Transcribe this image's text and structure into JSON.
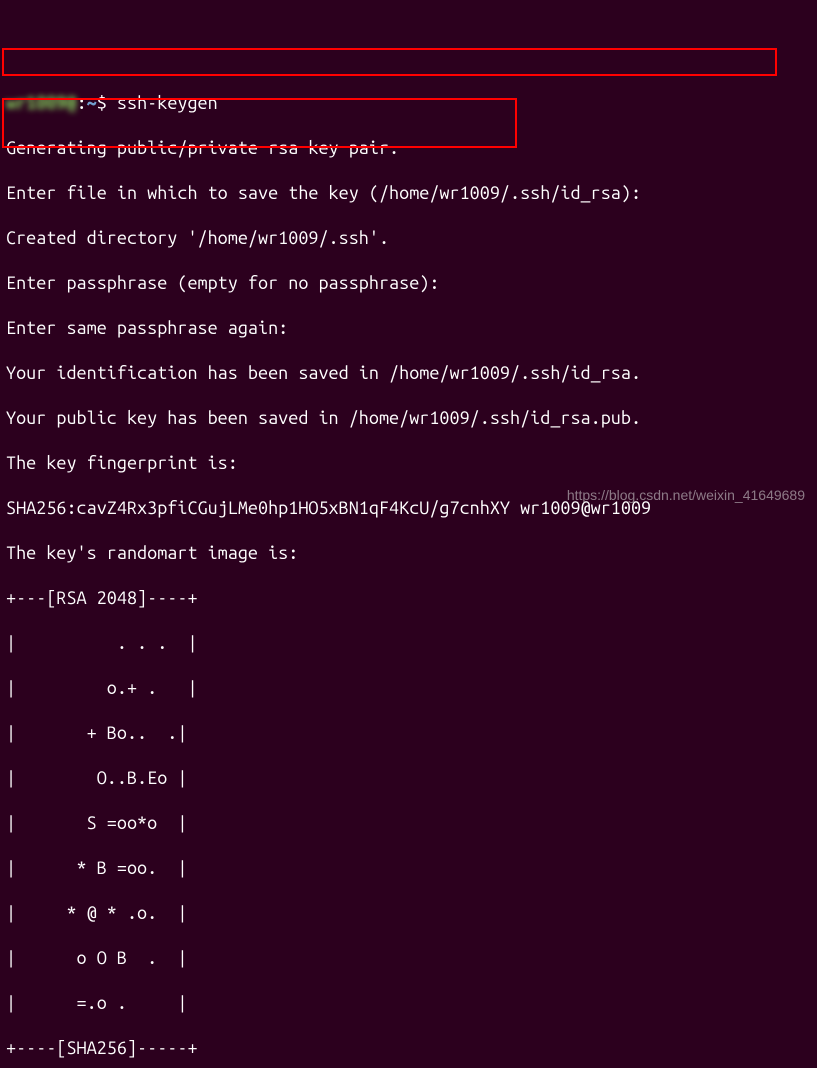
{
  "prompt": {
    "user_blurred": "wr1009@",
    "path": "~",
    "symbol": "$",
    "command": "ssh-keygen"
  },
  "lines": {
    "l1": "Generating public/private rsa key pair.",
    "l2": "Enter file in which to save the key (/home/wr1009/.ssh/id_rsa):",
    "l3": "Created directory '/home/wr1009/.ssh'.",
    "l4": "Enter passphrase (empty for no passphrase):",
    "l5": "Enter same passphrase again:",
    "l6": "Your identification has been saved in /home/wr1009/.ssh/id_rsa.",
    "l7": "Your public key has been saved in /home/wr1009/.ssh/id_rsa.pub.",
    "l8": "The key fingerprint is:",
    "l9": "SHA256:cavZ4Rx3pfiCGujLMe0hp1HO5xBN1qF4KcU/g7cnhXY wr1009@wr1009",
    "l10": "The key's randomart image is:",
    "l11": "+---[RSA 2048]----+",
    "l12": "|          . . .  |",
    "l13": "|         o.+ .   |",
    "l14": "|       + Bo..  .|",
    "l15": "|        O..B.Eo |",
    "l16": "|       S =oo*o  |",
    "l17": "|      * B =oo.  |",
    "l18": "|     * @ * .o.  |",
    "l19": "|      o O B  .  |",
    "l20": "|      =.o .     |",
    "l21": "+----[SHA256]-----+"
  },
  "watermark": "https://blog.csdn.net/weixin_41649689"
}
